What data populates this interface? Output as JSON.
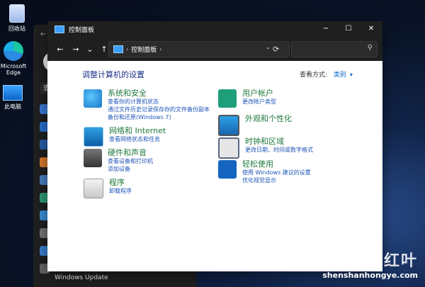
{
  "desktop": {
    "icons": [
      {
        "label": "回收站"
      },
      {
        "label": "Microsoft Edge"
      },
      {
        "label": "此电脑"
      }
    ]
  },
  "settings_window": {
    "back": "←",
    "search_text": "查",
    "bottom_item": "Windows Update"
  },
  "control_panel": {
    "window_title": "控制面板",
    "controls": {
      "minimize": "−",
      "maximize": "☐",
      "close": "✕"
    },
    "nav": {
      "back": "←",
      "forward": "→",
      "recent": "⌄",
      "up": "↑"
    },
    "address": {
      "crumb": "控制面板",
      "sep_before": "›",
      "sep_after": "›",
      "dropdown": "⌄"
    },
    "refresh": "⟳",
    "search_icon": "⚲",
    "heading": "调整计算机的设置",
    "view_by": {
      "label": "查看方式:",
      "value": "类别",
      "arrow": "▾"
    },
    "categories_left": [
      {
        "title": "系统和安全",
        "links": [
          "查看你的计算机状态",
          "通过文件历史记录保存你的文件备份副本",
          "备份和还原(Windows 7)"
        ],
        "icon": "shield-icon"
      },
      {
        "title": "网络和 Internet",
        "links": [
          "查看网络状态和任务"
        ],
        "icon": "network-icon"
      },
      {
        "title": "硬件和声音",
        "links": [
          "查看设备和打印机",
          "添加设备"
        ],
        "icon": "printer-icon"
      },
      {
        "title": "程序",
        "links": [
          "卸载程序"
        ],
        "icon": "programs-icon"
      }
    ],
    "categories_right": [
      {
        "title": "用户帐户",
        "links": [
          "更改帐户类型"
        ],
        "icon": "user-icon"
      },
      {
        "title": "外观和个性化",
        "links": [],
        "icon": "monitor-icon"
      },
      {
        "title": "时钟和区域",
        "links": [
          "更改日期、时间或数字格式"
        ],
        "icon": "clock-icon"
      },
      {
        "title": "轻松使用",
        "links": [
          "使用 Windows 建议的设置",
          "优化视觉显示"
        ],
        "icon": "accessibility-icon"
      }
    ]
  },
  "watermark": {
    "top": "深山红叶",
    "bottom": "shenshanhongye.com"
  }
}
